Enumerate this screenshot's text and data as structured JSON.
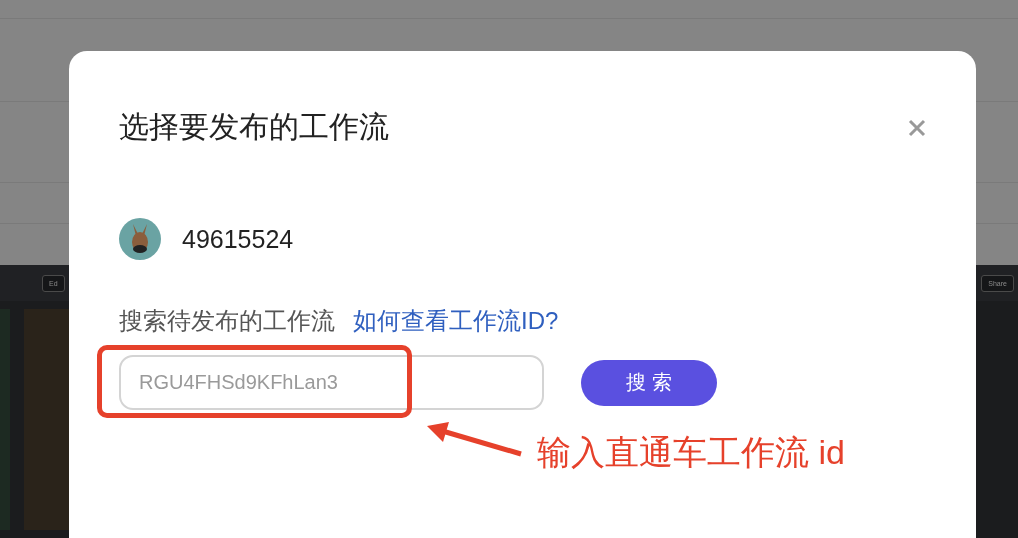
{
  "background": {
    "toolbar_buttons": [
      {
        "label": "Ed"
      },
      {
        "label": "Share"
      }
    ]
  },
  "dialog": {
    "title": "选择要发布的工作流",
    "account": {
      "id": "49615524"
    },
    "search": {
      "label": "搜索待发布的工作流",
      "help_link": "如何查看工作流ID?",
      "placeholder": "RGU4FHSd9KFhLan3",
      "button": "搜 索"
    }
  },
  "annotation": {
    "text": "输入直通车工作流 id"
  }
}
